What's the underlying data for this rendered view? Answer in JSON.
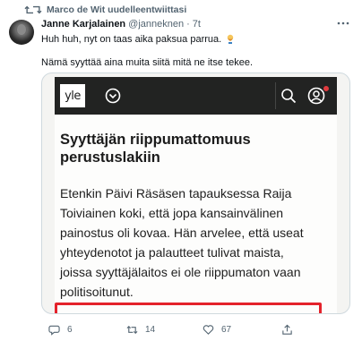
{
  "retweet": {
    "label": "Marco de Wit uudelleentwiittasi"
  },
  "tweet": {
    "author_name": "Janne Karjalainen",
    "author_handle": "@janneknen",
    "separator": "·",
    "time": "7t",
    "text_line1": "Huh huh, nyt on taas aika paksua parrua.",
    "text_line2": "Nämä syyttää aina muita siitä mitä ne itse tekee.",
    "emoji": "man-with-beard-emoji"
  },
  "media": {
    "site_logo": "yle",
    "headline": "Syyttäjän riippumattomuus perustuslakiin",
    "body_lines": [
      "Etenkin Päivi Räsäsen tapauksessa Raija",
      "Toiviainen koki, että jopa kansainvälinen",
      "painostus oli kovaa. Hän arvelee, että useat",
      "yhteydenotot ja palautteet tulivat maista,",
      "joissa syyttäjälaitos ei ole riippumaton vaan",
      "politisoitunut."
    ],
    "highlight_color": "#e4222b"
  },
  "actions": {
    "reply_count": "6",
    "retweet_count": "14",
    "like_count": "67"
  },
  "colors": {
    "accent": "#1d9bf0",
    "muted": "#536471",
    "yle_bar": "#222322"
  }
}
